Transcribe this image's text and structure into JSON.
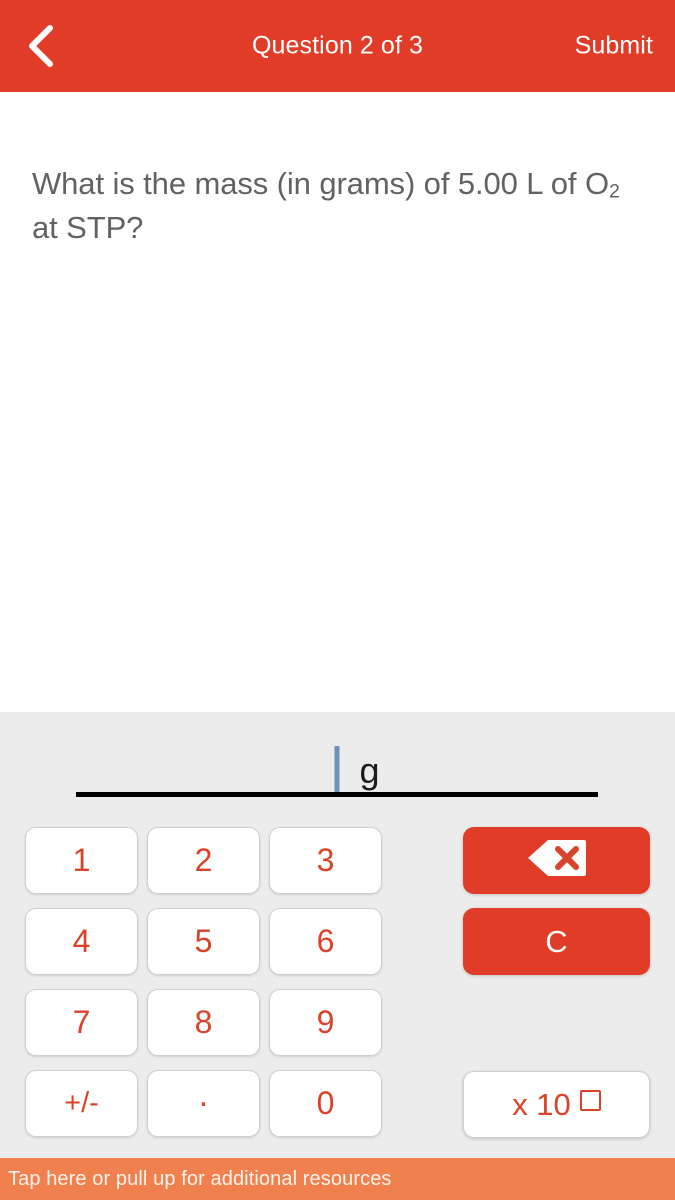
{
  "header": {
    "back_icon": "chevron-left-icon",
    "title": "Question 2 of 3",
    "submit_label": "Submit",
    "background_color": "#e13c27",
    "text_color": "#ffffff"
  },
  "question": {
    "text_part1": "What is the mass (in grams) of 5.00 L of O",
    "subscript": "2",
    "text_part2": " at STP?",
    "text_color": "#626262"
  },
  "answer": {
    "value": "",
    "unit": "g",
    "caret_color": "#6d93b8",
    "underline_color": "#000000"
  },
  "keypad": {
    "keys": [
      {
        "label": "1",
        "name": "key-1"
      },
      {
        "label": "2",
        "name": "key-2"
      },
      {
        "label": "3",
        "name": "key-3"
      },
      {
        "label": "4",
        "name": "key-4"
      },
      {
        "label": "5",
        "name": "key-5"
      },
      {
        "label": "6",
        "name": "key-6"
      },
      {
        "label": "7",
        "name": "key-7"
      },
      {
        "label": "8",
        "name": "key-8"
      },
      {
        "label": "9",
        "name": "key-9"
      },
      {
        "label": "+/-",
        "name": "key-sign"
      },
      {
        "label": ".",
        "name": "key-decimal"
      },
      {
        "label": "0",
        "name": "key-0"
      }
    ],
    "key_text_color": "#d8432a",
    "key_background": "#ffffff",
    "panel_background": "#ececec"
  },
  "actions": {
    "backspace_icon": "backspace-delete-icon",
    "clear_label": "C",
    "exponent_label": "x 10",
    "exponent_placeholder_icon": "empty-square-icon",
    "red_color": "#e13c27"
  },
  "bottom_bar": {
    "text": "Tap here or pull up for additional resources",
    "background_color": "#f0814f",
    "text_color": "#fdf3ec"
  }
}
